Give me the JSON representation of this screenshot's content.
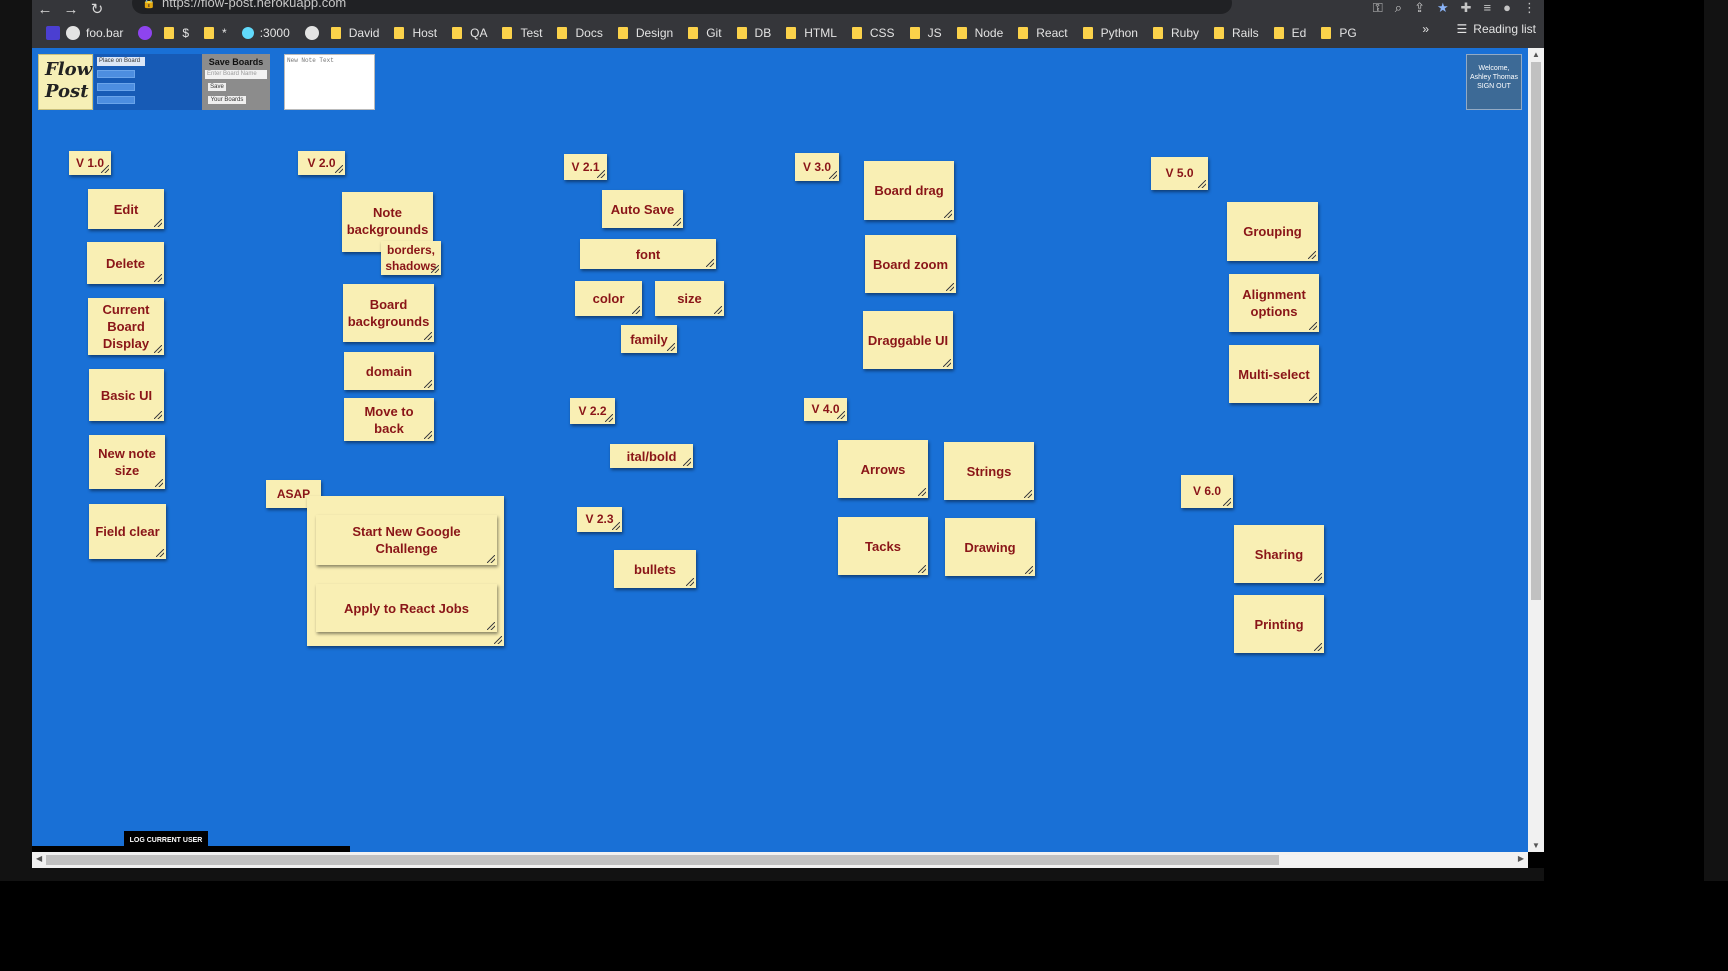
{
  "browser": {
    "url": "https://flow-post.herokuapp.com",
    "bookmarks": [
      "foo.bar",
      "$",
      "*",
      ":3000",
      "David",
      "Host",
      "QA",
      "Test",
      "Docs",
      "Design",
      "Git",
      "DB",
      "HTML",
      "CSS",
      "JS",
      "Node",
      "React",
      "Python",
      "Ruby",
      "Rails",
      "Ed",
      "PG"
    ],
    "more": "»",
    "reading_list": "Reading list"
  },
  "toolbar": {
    "logo_line1": "Flow",
    "logo_line2": "Post",
    "place_on_board": "Place on Board",
    "save_boards_title": "Save Boards",
    "board_name_placeholder": "Enter Board Name",
    "save_button": "Save",
    "your_boards_button": "Your Boards",
    "new_note_placeholder": "New Note Text"
  },
  "user": {
    "welcome": "Welcome,",
    "name": "Ashley Thomas",
    "signout": "SIGN OUT"
  },
  "notes": [
    {
      "id": "v10",
      "text": "V 1.0"
    },
    {
      "id": "edit",
      "text": "Edit"
    },
    {
      "id": "delete",
      "text": "Delete"
    },
    {
      "id": "current-board",
      "text": "Current Board Display"
    },
    {
      "id": "basic-ui",
      "text": "Basic UI"
    },
    {
      "id": "new-note-size",
      "text": "New note size"
    },
    {
      "id": "field-clear",
      "text": "Field clear"
    },
    {
      "id": "v20",
      "text": "V 2.0"
    },
    {
      "id": "note-bg",
      "text": "Note backgrounds"
    },
    {
      "id": "borders",
      "text": "borders, shadows"
    },
    {
      "id": "board-bg",
      "text": "Board backgrounds"
    },
    {
      "id": "domain",
      "text": "domain"
    },
    {
      "id": "move-back",
      "text": "Move to back"
    },
    {
      "id": "asap",
      "text": "ASAP"
    },
    {
      "id": "google",
      "text": "Start New Google Challenge"
    },
    {
      "id": "react-jobs",
      "text": "Apply to React Jobs"
    },
    {
      "id": "v21",
      "text": "V 2.1"
    },
    {
      "id": "auto-save",
      "text": "Auto Save"
    },
    {
      "id": "font",
      "text": "font"
    },
    {
      "id": "color",
      "text": "color"
    },
    {
      "id": "size",
      "text": "size"
    },
    {
      "id": "family",
      "text": "family"
    },
    {
      "id": "v22",
      "text": "V 2.2"
    },
    {
      "id": "ital-bold",
      "text": "ital/bold"
    },
    {
      "id": "v23",
      "text": "V 2.3"
    },
    {
      "id": "bullets",
      "text": "bullets"
    },
    {
      "id": "v30",
      "text": "V 3.0"
    },
    {
      "id": "board-drag",
      "text": "Board drag"
    },
    {
      "id": "board-zoom",
      "text": "Board zoom"
    },
    {
      "id": "draggable-ui",
      "text": "Draggable UI"
    },
    {
      "id": "v40",
      "text": "V 4.0"
    },
    {
      "id": "arrows",
      "text": "Arrows"
    },
    {
      "id": "strings",
      "text": "Strings"
    },
    {
      "id": "tacks",
      "text": "Tacks"
    },
    {
      "id": "drawing",
      "text": "Drawing"
    },
    {
      "id": "v50",
      "text": "V 5.0"
    },
    {
      "id": "grouping",
      "text": "Grouping"
    },
    {
      "id": "alignment",
      "text": "Alignment options"
    },
    {
      "id": "multi-select",
      "text": "Multi-select"
    },
    {
      "id": "v60",
      "text": "V 6.0"
    },
    {
      "id": "sharing",
      "text": "Sharing"
    },
    {
      "id": "printing",
      "text": "Printing"
    }
  ],
  "footer": {
    "log_button": "LOG CURRENT USER"
  },
  "colors": {
    "board": "#1970d6",
    "note": "#f9efb4",
    "note_text": "#8a1518"
  }
}
